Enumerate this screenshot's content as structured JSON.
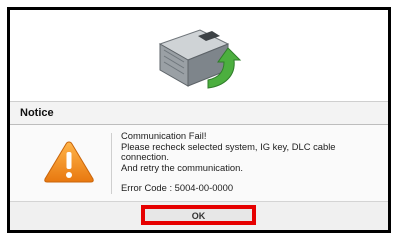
{
  "dialog": {
    "title": "Notice",
    "message_lines": [
      "Communication Fail!",
      "Please recheck selected system, IG key, DLC cable",
      "connection.",
      "And retry the communication."
    ],
    "error_line": "Error Code : 5004-00-0000",
    "ok_label": "OK"
  },
  "icons": {
    "top_graphic": "ecu-module-with-green-return-arrow",
    "warning": "warning-triangle-icon"
  },
  "colors": {
    "warning_orange": "#f08a1c",
    "arrow_green": "#4caf3f",
    "highlight_red": "#e60000"
  }
}
